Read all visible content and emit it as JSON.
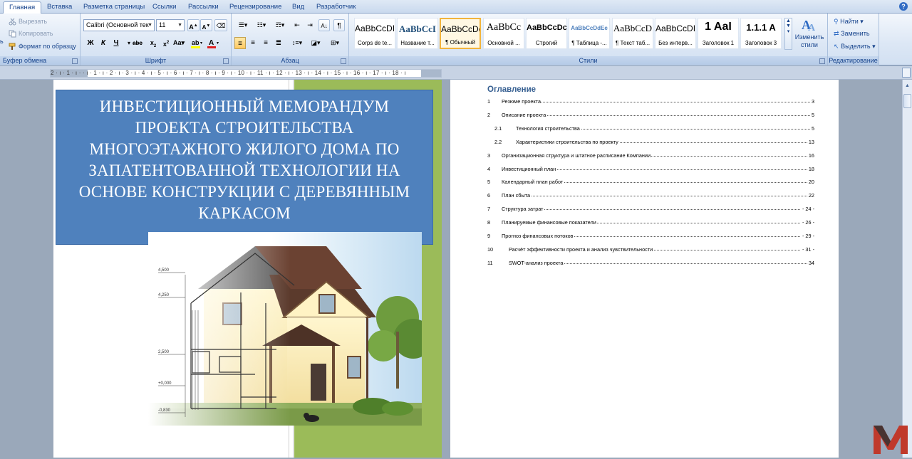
{
  "tabs": [
    {
      "label": "Главная",
      "active": true
    },
    {
      "label": "Вставка"
    },
    {
      "label": "Разметка страницы"
    },
    {
      "label": "Ссылки"
    },
    {
      "label": "Рассылки"
    },
    {
      "label": "Рецензирование"
    },
    {
      "label": "Вид"
    },
    {
      "label": "Разработчик"
    }
  ],
  "clipboard": {
    "cut": "Вырезать",
    "copy": "Копировать",
    "format_painter": "Формат по образцу",
    "group_label": "Буфер обмена",
    "paste_partial": "ь"
  },
  "font": {
    "name": "Calibri (Основной тек",
    "size": "11",
    "group_label": "Шрифт"
  },
  "paragraph": {
    "group_label": "Абзац"
  },
  "styles": {
    "group_label": "Стили",
    "items": [
      {
        "sample": "AaBbCcDІ",
        "name": "Corps de te..."
      },
      {
        "sample": "AaBbCcI",
        "name": "Название т..."
      },
      {
        "sample": "AaBbCcDd",
        "name": "¶ Обычный",
        "selected": true
      },
      {
        "sample": "AaBbCc",
        "name": "Основной ..."
      },
      {
        "sample": "AaBbCcDc",
        "name": "Строгий"
      },
      {
        "sample": "AaBbCcDdEe",
        "name": "¶ Таблица -..."
      },
      {
        "sample": "AaBbCcD",
        "name": "¶ Текст таб..."
      },
      {
        "sample": "AaBbCcDІ",
        "name": "Без интерв..."
      },
      {
        "sample": "1 AaI",
        "name": "Заголовок 1"
      },
      {
        "sample": "1.1.1 A",
        "name": "Заголовок 3"
      }
    ],
    "change_styles": "Изменить стили"
  },
  "editing": {
    "find": "Найти",
    "replace": "Заменить",
    "select": "Выделить",
    "group_label": "Редактирование"
  },
  "ruler": {
    "text": "2 · ı · 1 · ı ·   · ı · 1 · ı · 2 · ı · 3 · ı · 4 · ı · 5 · ı · 6 · ı · 7 · ı · 8 · ı · 9 · ı · 10 · ı · 11 · ı · 12 · ı · 13 · ı · 14 · ı · 15 · ı · 16 · ı · 17 · ı · 18 · ı"
  },
  "cover": {
    "title": "ИНВЕСТИЦИОННЫЙ МЕМОРАНДУМ ПРОЕКТА СТРОИТЕЛЬСТВА МНОГОЭТАЖНОГО ЖИЛОГО ДОМА ПО ЗАПАТЕНТОВАННОЙ ТЕХНОЛОГИИ НА ОСНОВЕ КОНСТРУКЦИИ С ДЕРЕВЯННЫМ КАРКАСОМ",
    "drawing_labels": [
      "4,500",
      "4,250",
      "2,500",
      "+0,000",
      "-0,830"
    ]
  },
  "toc": {
    "title": "Оглавление",
    "items": [
      {
        "num": "1",
        "text": "Резюме проекта",
        "page": "3",
        "indent": 0
      },
      {
        "num": "2",
        "text": "Описание проекта",
        "page": "5",
        "indent": 0
      },
      {
        "num": "2.1",
        "text": "Технология строительства",
        "page": "5",
        "indent": 1
      },
      {
        "num": "2.2",
        "text": "Характеристики строительства по проекту",
        "page": "13",
        "indent": 1
      },
      {
        "num": "3",
        "text": "Организационная структура и штатное расписание Компании",
        "page": "16",
        "indent": 0
      },
      {
        "num": "4",
        "text": "Инвестиционный план",
        "page": "18",
        "indent": 0
      },
      {
        "num": "5",
        "text": "Календарный план работ",
        "page": "20",
        "indent": 0
      },
      {
        "num": "6",
        "text": "План сбыта",
        "page": "22",
        "indent": 0
      },
      {
        "num": "7",
        "text": "Структура затрат",
        "page": "- 24 -",
        "indent": 0
      },
      {
        "num": "8",
        "text": "Планируемые финансовые показатели",
        "page": "- 26 -",
        "indent": 0
      },
      {
        "num": "9",
        "text": "Прогноз финансовых потоков",
        "page": "- 29 -",
        "indent": 0
      },
      {
        "num": "10",
        "text": "Расчёт эффективности проекта и анализ чувствительности",
        "page": "- 31 -",
        "indent": 2
      },
      {
        "num": "11",
        "text": "SWOT-анализ проекта",
        "page": "34",
        "indent": 2
      }
    ]
  },
  "colors": {
    "cover_blue": "#4f81bd",
    "cover_green": "#9bbb59",
    "toc_heading": "#365f91",
    "logo_red": "#c0392b"
  }
}
